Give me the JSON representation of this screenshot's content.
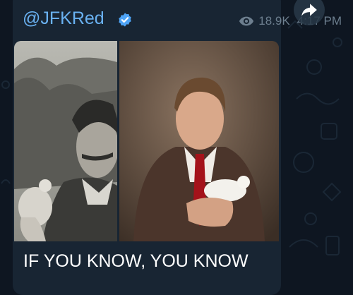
{
  "post": {
    "channel": "@JFKRed",
    "verified": true,
    "views": "18.9K",
    "time": "4:17 PM",
    "caption": "IF YOU KNOW, YOU KNOW"
  },
  "icons": {
    "verified": "verified-badge-icon",
    "views": "eye-icon",
    "share": "share-arrow-icon"
  },
  "colors": {
    "background": "#0e1621",
    "bubble": "#182533",
    "channel_name": "#6ab2f2",
    "meta_text": "#6d7f8f",
    "caption_text": "#ffffff",
    "verified_badge": "#4ea4f6"
  }
}
